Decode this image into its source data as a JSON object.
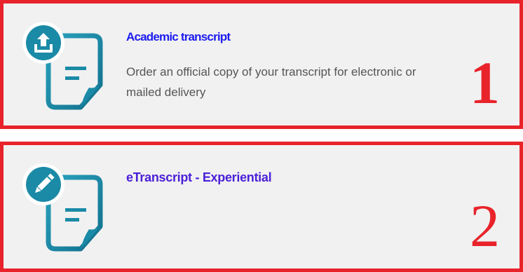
{
  "colors": {
    "border": "#e8232a",
    "card_bg": "#f1f1f1",
    "icon_teal": "#1a8aa6",
    "link_blue": "#1c1cf0",
    "link_violet": "#4a1fd8"
  },
  "cards": [
    {
      "icon": "document-upload-icon",
      "title": "Academic transcript",
      "description": "Order an official copy of your transcript for electronic or mailed delivery",
      "number": "1"
    },
    {
      "icon": "document-edit-icon",
      "title": "eTranscript - Experiential",
      "description": "",
      "number": "2"
    }
  ]
}
